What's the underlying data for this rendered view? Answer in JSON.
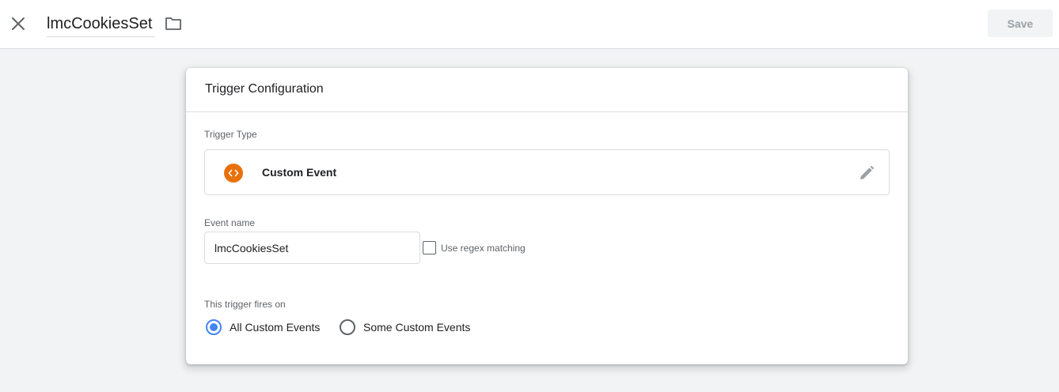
{
  "header": {
    "title": "lmcCookiesSet",
    "save_label": "Save"
  },
  "icons": {
    "close": "close-icon",
    "folder": "folder-icon",
    "trigger_type": "custom-event-code-icon",
    "edit": "pencil-icon"
  },
  "colors": {
    "accent": "#4285f4",
    "custom_event_icon": "#e8710a",
    "save_disabled_text": "#9aa0a6"
  },
  "card": {
    "title": "Trigger Configuration",
    "trigger_type": {
      "label": "Trigger Type",
      "value": "Custom Event"
    },
    "event_name": {
      "label": "Event name",
      "value": "lmcCookiesSet",
      "regex_label": "Use regex matching",
      "regex_checked": false
    },
    "fires_on": {
      "label": "This trigger fires on",
      "options": [
        {
          "label": "All Custom Events",
          "selected": true
        },
        {
          "label": "Some Custom Events",
          "selected": false
        }
      ]
    }
  }
}
